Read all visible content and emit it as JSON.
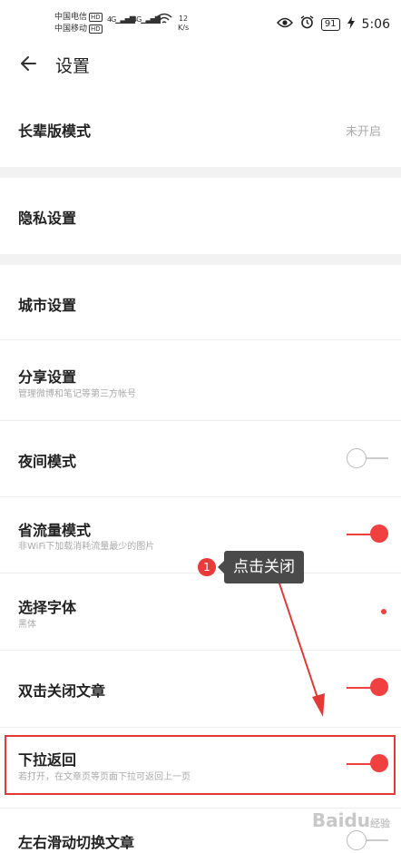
{
  "status": {
    "carrier1": "中国电信",
    "carrier2": "中国移动",
    "hd": "HD",
    "net1": "4G",
    "net2": "4G",
    "speed_value": "12",
    "speed_unit": "K/s",
    "battery": "91",
    "time": "5:06"
  },
  "header": {
    "title": "设置"
  },
  "rows": {
    "elder_mode": {
      "label": "长辈版模式",
      "value": "未开启"
    },
    "privacy": {
      "label": "隐私设置"
    },
    "city": {
      "label": "城市设置"
    },
    "share": {
      "label": "分享设置",
      "sub": "管理微博和笔记等第三方帐号"
    },
    "night": {
      "label": "夜间模式",
      "on": false
    },
    "data_saver": {
      "label": "省流量模式",
      "sub": "非WiFi下加载消耗流量最少的图片",
      "on": true
    },
    "font": {
      "label": "选择字体",
      "sub": "黑体"
    },
    "double_tap": {
      "label": "双击关闭文章",
      "on": true
    },
    "pull_back": {
      "label": "下拉返回",
      "sub": "若打开，在文章页等页面下拉可返回上一页",
      "on": true
    },
    "swipe": {
      "label": "左右滑动切换文章",
      "on": false
    }
  },
  "annotation": {
    "number": "1",
    "text": "点击关闭"
  },
  "watermark": {
    "brand": "Baidu",
    "sub": "经验"
  },
  "colors": {
    "accent": "#f04040",
    "annotation_border": "#e53935"
  }
}
